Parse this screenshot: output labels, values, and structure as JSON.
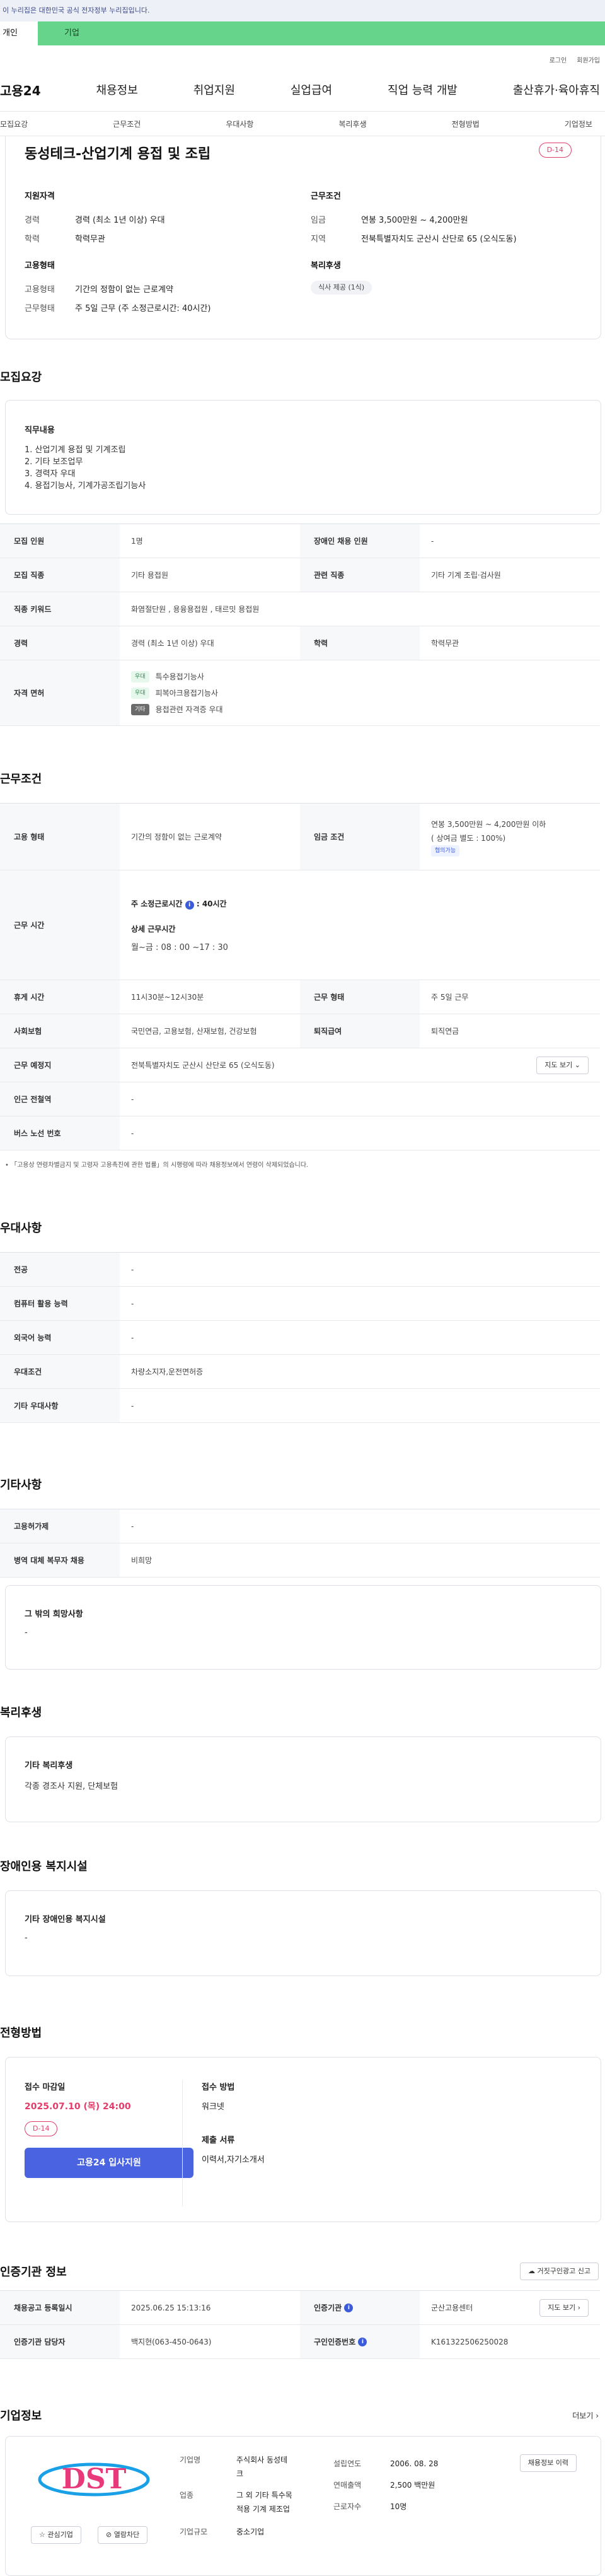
{
  "gov_banner": "이 누리집은 대한민국 공식 전자정부 누리집입니다.",
  "tabs": {
    "personal": "개인",
    "business": "기업"
  },
  "util": {
    "login": "로그인",
    "signup": "회원가입"
  },
  "gnb": {
    "logo": "고용24",
    "menu": [
      "채용정보",
      "취업지원",
      "실업급여",
      "직업 능력 개발",
      "출산휴가·육아휴직"
    ]
  },
  "subnav": [
    "모집요강",
    "근무조건",
    "우대사항",
    "복리후생",
    "전형방법",
    "기업정보"
  ],
  "job": {
    "title": "동성테크-산업기계 용접 및 조립",
    "dday": "D-14",
    "summary": {
      "qual_title": "지원자격",
      "career_k": "경력",
      "career_v": "경력 (최소 1년 이상) 우대",
      "edu_k": "학력",
      "edu_v": "학력무관",
      "cond_title": "근무조건",
      "wage_k": "임금",
      "wage_v": "연봉 3,500만원 ~ 4,200만원",
      "region_k": "지역",
      "region_v": "전북특별자치도 군산시 산단로 65 (오식도동)",
      "emp_title": "고용형태",
      "type_k": "고용형태",
      "type_v": "기간의 정함이 없는 근로계약",
      "shape_k": "근무형태",
      "shape_v": "주 5일 근무 (주 소정근로시간: 40시간)",
      "welfare_title": "복리후생",
      "welfare_tag": "식사 제공 (1식)"
    }
  },
  "recruit": {
    "title": "모집요강",
    "duty_title": "직무내용",
    "duties": [
      "1. 산업기계 용접 및 기계조립",
      "2. 기타 보조업무",
      "3. 경력자 우대",
      "4. 용접기능사, 기계가공조립기능사"
    ],
    "rows": {
      "count_k": "모집 인원",
      "count_v": "1명",
      "disabled_k": "장애인 채용 인원",
      "disabled_v": "-",
      "job_k": "모집 직종",
      "job_v": "기타 용접원",
      "related_k": "관련 직종",
      "related_v": "기타 기계 조립·검사원",
      "kw_k": "직종 키워드",
      "kw_v": "화염절단원 , 용융용접원 , 태르밋 용접원",
      "career_k": "경력",
      "career_v": "경력 (최소 1년 이상) 우대",
      "edu_k": "학력",
      "edu_v": "학력무관",
      "license_k": "자격 면허",
      "licenses": [
        {
          "badge": "우대",
          "name": "특수용접기능사"
        },
        {
          "badge": "우대",
          "name": "피복아크용접기능사"
        },
        {
          "badge": "기타",
          "name": "용접관련 자격증 우대"
        }
      ]
    }
  },
  "work": {
    "title": "근무조건",
    "emp_k": "고용 형태",
    "emp_v": "기간의 정함이 없는 근로계약",
    "wage_k": "임금 조건",
    "wage_v1": "연봉 3,500만원 ~ 4,200만원 이하",
    "wage_v2": "( 상여금 별도 : 100%)",
    "wage_tag": "협의가능",
    "hours_k": "근무 시간",
    "hours_main": "주 소정근로시간",
    "hours_main_v": ": 40시간",
    "hours_detail_title": "상세 근무시간",
    "hours_detail": "월~금 : 08 : 00 ~17 : 30",
    "break_k": "휴게 시간",
    "break_v": "11시30분~12시30분",
    "form_k": "근무 형태",
    "form_v": "주 5일 근무",
    "ins_k": "사회보험",
    "ins_v": "국민연금, 고용보험, 산재보험, 건강보험",
    "ret_k": "퇴직급여",
    "ret_v": "퇴직연금",
    "place_k": "근무 예정지",
    "place_v": "전북특별자치도 군산시 산단로 65 (오식도동)",
    "map_btn": "지도 보기",
    "sub_k": "인근 전철역",
    "sub_v": "-",
    "bus_k": "버스 노선 번호",
    "bus_v": "-",
    "note": "「고용상 연령차별금지 및 고령자 고용촉진에 관한 법률」의 시행령에 따라 채용정보에서 연령이 삭제되었습니다."
  },
  "pref": {
    "title": "우대사항",
    "major_k": "전공",
    "major_v": "-",
    "pc_k": "컴퓨터 활용 능력",
    "pc_v": "-",
    "lang_k": "외국어 능력",
    "lang_v": "-",
    "cond_k": "우대조건",
    "cond_v": "차량소지자,운전면허증",
    "etc_k": "기타 우대사항",
    "etc_v": "-"
  },
  "other": {
    "title": "기타사항",
    "law_k": "고용허가제",
    "law_v": "-",
    "mil_k": "병역 대체 복무자 채용",
    "mil_v": "비희망",
    "hope_title": "그 밖의 희망사항",
    "hope_v": "-"
  },
  "welfare": {
    "title": "복리후생",
    "box_title": "기타 복리후생",
    "box_v": "각종 경조사 지원, 단체보험"
  },
  "disability": {
    "title": "장애인용 복지시설",
    "box_title": "기타 장애인용 복지시설",
    "box_v": "-"
  },
  "process": {
    "title": "전형방법",
    "deadline_title": "접수 마감일",
    "deadline": "2025.07.10 (목) 24:00",
    "dday": "D-14",
    "apply_btn": "고용24 입사지원",
    "method_title": "접수 방법",
    "method_v": "워크넷",
    "docs_title": "제출 서류",
    "docs_v": "이력서,자기소개서"
  },
  "cert": {
    "title": "인증기관 정보",
    "report_btn": "거짓구인광고 신고",
    "reg_k": "채용공고 등록일시",
    "reg_v": "2025.06.25 15:13:16",
    "agency_k": "인증기관",
    "agency_v": "군산고용센터",
    "map_btn": "지도 보기",
    "officer_k": "인증기관 담당자",
    "officer_v": "백지현(063-450-0643)",
    "num_k": "구인인증번호",
    "num_v": "K161322506250028"
  },
  "company": {
    "title": "기업정보",
    "more": "더보기",
    "logo_text": "DST",
    "fav_btn": "관심기업",
    "block_btn": "열람차단",
    "name_k": "기업명",
    "name_v1": "주식회사 동성테",
    "name_v2": "크",
    "biz_k": "업종",
    "biz_v1": "그 외 기타 특수목",
    "biz_v2": "적용 기계 제조업",
    "size_k": "기업규모",
    "size_v": "중소기업",
    "year_k": "설립연도",
    "year_v": "2006. 08. 28",
    "sales_k": "연매출액",
    "sales_v": "2,500 백만원",
    "emp_k": "근로자수",
    "emp_v": "10명",
    "jobs_btn": "채용정보 이력"
  }
}
